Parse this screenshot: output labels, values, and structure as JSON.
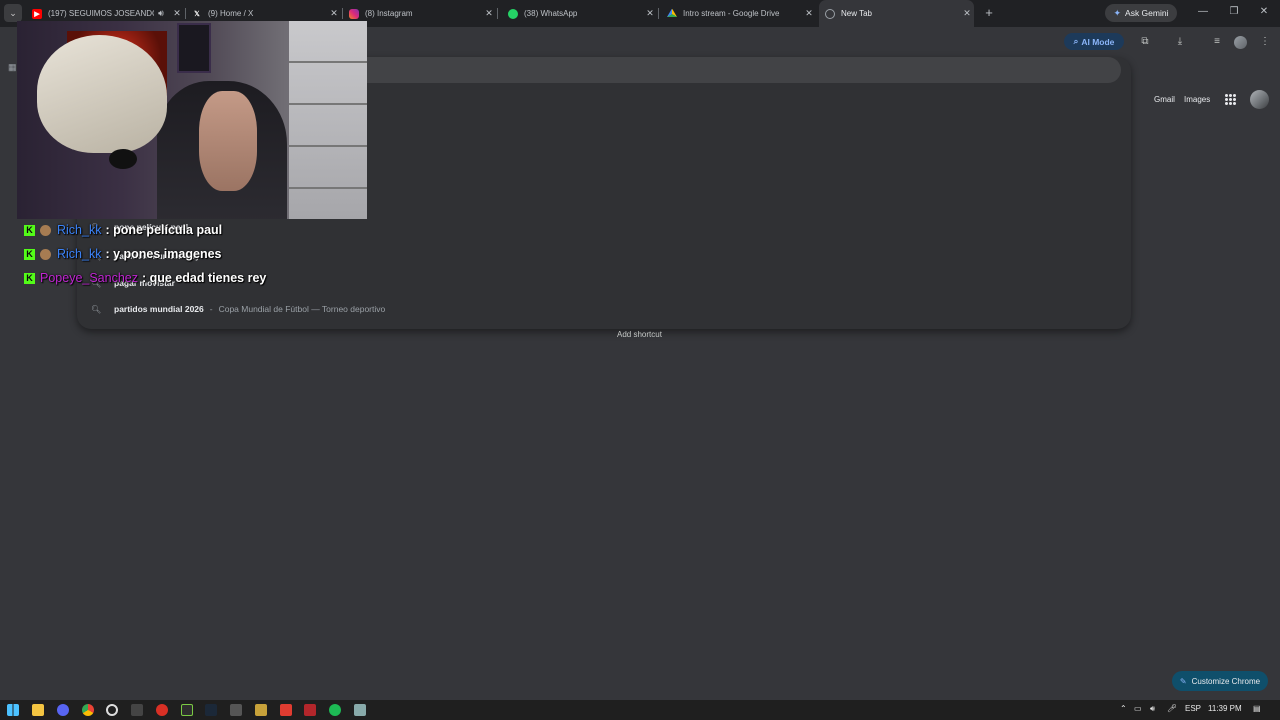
{
  "tabs": [
    {
      "title": "(197) SEGUIMOS JOSEANDO",
      "favicon": "youtube-icon",
      "color": "#ff0000",
      "muted_icon": "speaker-icon"
    },
    {
      "title": "(9) Home / X",
      "favicon": "x-icon",
      "color": "#ffffff"
    },
    {
      "title": "(8) Instagram",
      "favicon": "instagram-icon",
      "color": "#e1306c"
    },
    {
      "title": "(38) WhatsApp",
      "favicon": "whatsapp-icon",
      "color": "#25d366"
    },
    {
      "title": "Intro stream - Google Drive",
      "favicon": "drive-icon",
      "color": "#34a853"
    },
    {
      "title": "New Tab",
      "favicon": "chrome-icon",
      "color": "#9aa0a6",
      "active": true
    }
  ],
  "gemini": {
    "label": "Ask Gemini"
  },
  "toolbar": {
    "ai_mode_label": "AI Mode"
  },
  "omnibox": {
    "suggestions": [
      {
        "query": "pone película paul"
      },
      {
        "query": "partidos mundial hoy"
      },
      {
        "query": "pagar movistar"
      },
      {
        "query": "partidos mundial 2026",
        "description": "Copa Mundial de Fútbol — Torneo deportivo"
      }
    ]
  },
  "ntp": {
    "gmail_label": "Gmail",
    "images_label": "Images",
    "add_shortcut_label": "Add shortcut",
    "customize_label": "Customize Chrome"
  },
  "chat": [
    {
      "user": "Rich_kk",
      "user_color": "#3b82f6",
      "message": ": pone película paul",
      "has_sub_badge": true
    },
    {
      "user": "Rich_kk",
      "user_color": "#3b82f6",
      "message": ": y pones imagenes",
      "has_sub_badge": true
    },
    {
      "user": "Popeye_Sanchez",
      "user_color": "#c026d3",
      "message": ": que edad tienes rey",
      "has_sub_badge": false
    }
  ],
  "taskbar": {
    "language": "ESP",
    "time": "11:39 PM"
  },
  "colors": {
    "accent": "#8ab4f8",
    "kick_green": "#53fc18",
    "page_bg": "#35363a"
  }
}
